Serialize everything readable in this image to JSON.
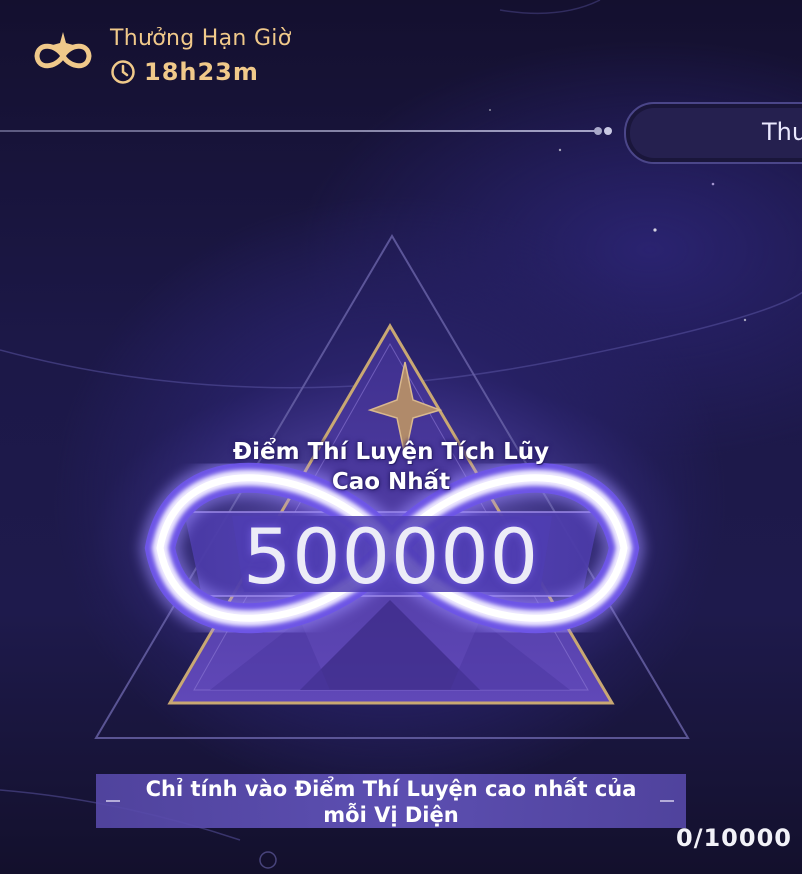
{
  "header": {
    "event_title": "Thưởng Hạn Giờ",
    "timer_value": "18h23m",
    "logo_icon": "infinity-star-emblem",
    "clock_icon": "clock-icon"
  },
  "tab": {
    "label": "Thư"
  },
  "score": {
    "title_line1": "Điểm Thí Luyện Tích Lũy",
    "title_line2": "Cao Nhất",
    "value": "500000",
    "emblem_icon": "infinity-triangle-emblem"
  },
  "note": {
    "line1": "Chỉ tính vào Điểm Thí Luyện cao nhất của",
    "line2": "mỗi Vị Diện"
  },
  "progress": {
    "text": "0/10000"
  },
  "colors": {
    "gold": "#f0c98a",
    "background": "#1e1a4c",
    "glow": "#9c8cff"
  }
}
